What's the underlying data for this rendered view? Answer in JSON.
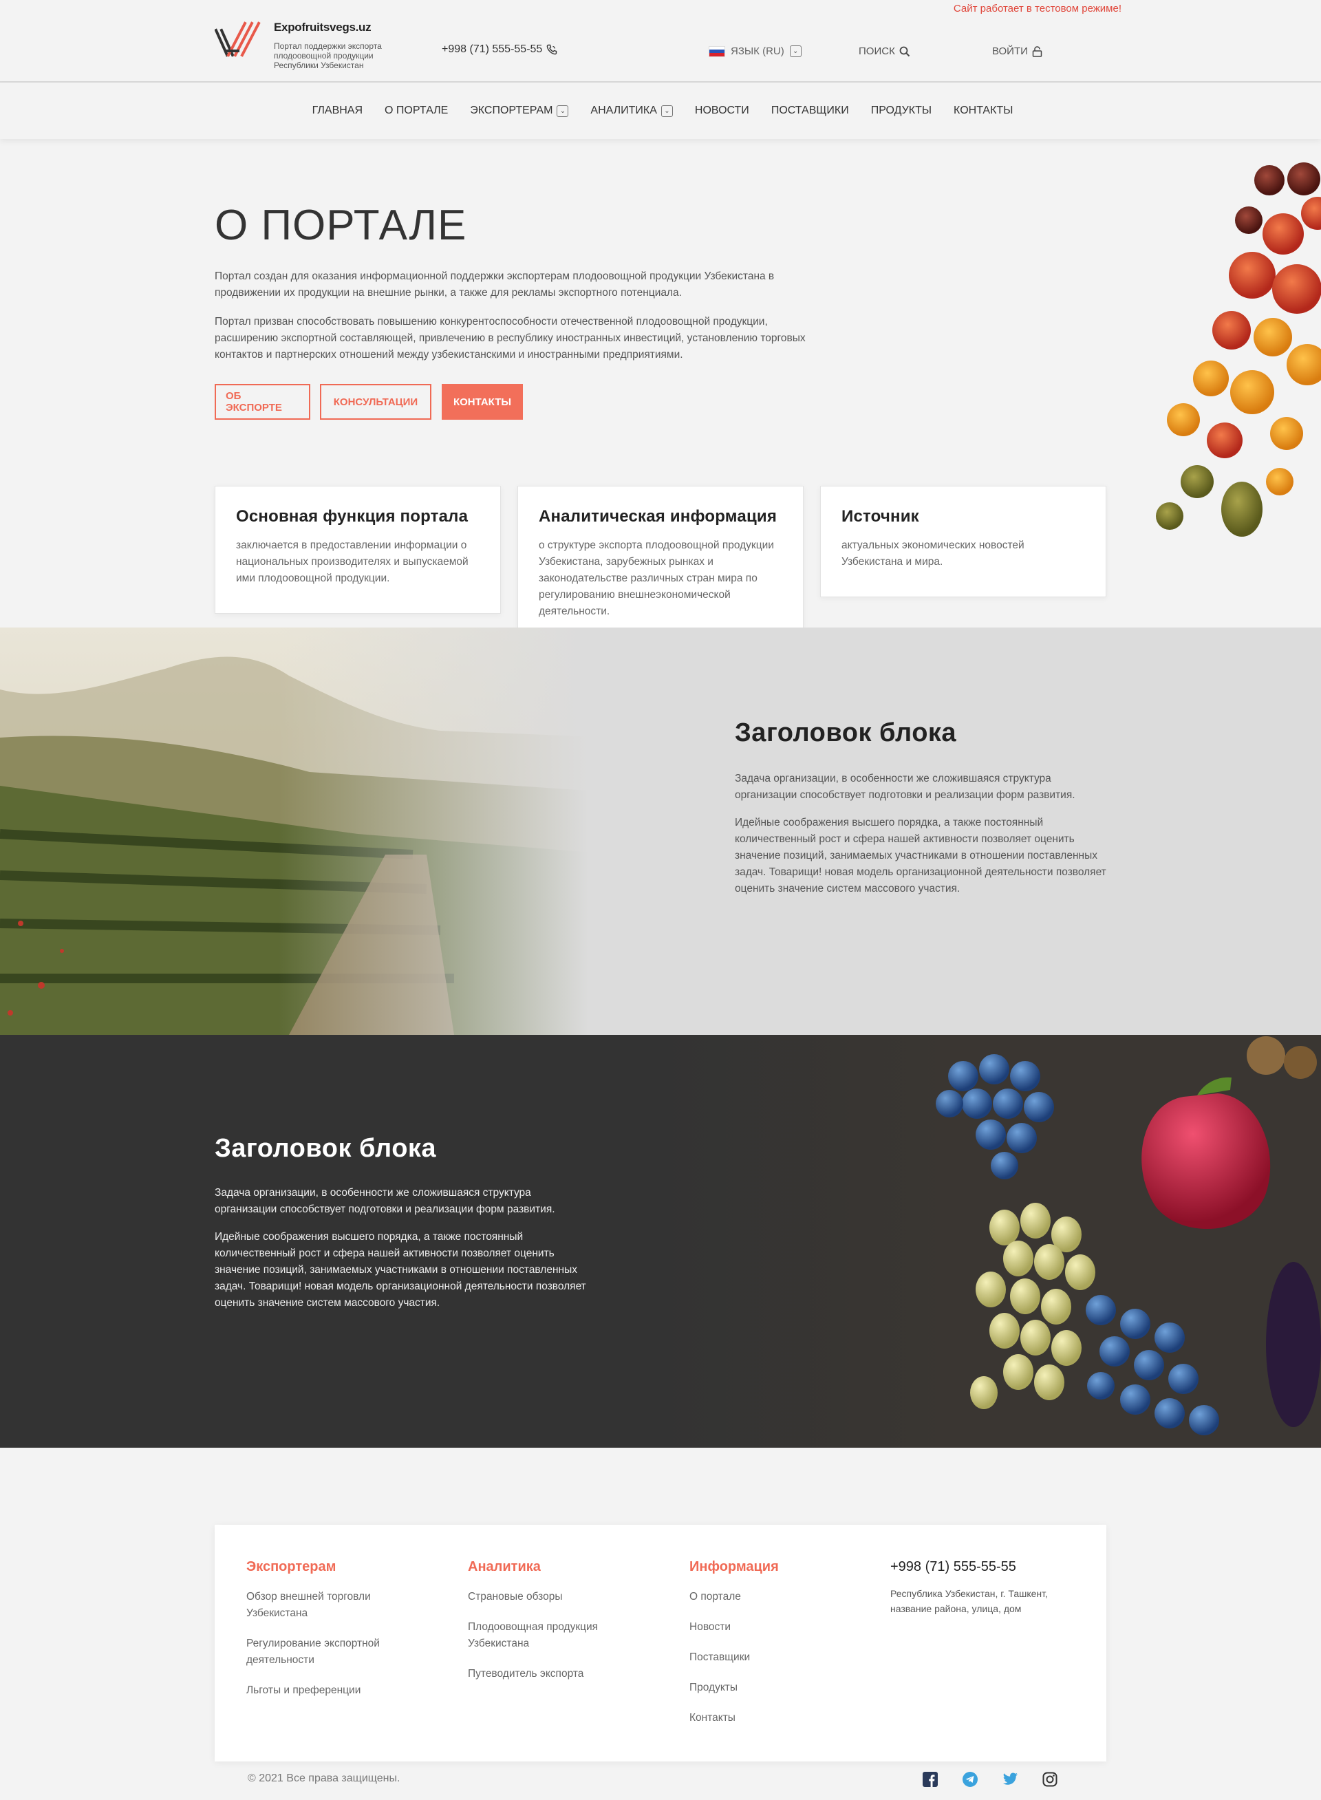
{
  "header": {
    "test_mode_notice": "Сайт работает в тестовом режиме!",
    "site_name": "Expofruitsvegs.uz",
    "site_description": "Портал поддержки экспорта плодоовощной продукции Республики Узбекистан",
    "phone": "+998 (71) 555-55-55",
    "language_label": "ЯЗЫК (RU)",
    "search_label": "ПОИСК",
    "login_label": "ВОЙТИ"
  },
  "nav": {
    "items": [
      {
        "label": "ГЛАВНАЯ"
      },
      {
        "label": "О ПОРТАЛЕ"
      },
      {
        "label": "ЭКСПОРТЕРАМ"
      },
      {
        "label": "АНАЛИТИКА"
      },
      {
        "label": "НОВОСТИ"
      },
      {
        "label": "ПОСТАВЩИКИ"
      },
      {
        "label": "ПРОДУКТЫ"
      },
      {
        "label": "КОНТАКТЫ"
      }
    ]
  },
  "hero": {
    "title": "О ПОРТАЛЕ",
    "paragraph_1": "Портал создан для оказания информационной поддержки  экспортерам плодоовощной продукции Узбекистана в продвижении их продукции на внешние рынки, а также для рекламы экспортного потенциала.",
    "paragraph_2": "Портал призван способствовать повышению конкурентоспособности отечественной плодоовощной продукции, расширению экспортной составляющей, привлечению в республику иностранных инвестиций, установлению торговых контактов и партнерских отношений между узбекистанскими и иностранными предприятиями.",
    "buttons": {
      "about_export": "ОБ ЭКСПОРТЕ",
      "consultations": "КОНСУЛЬТАЦИИ",
      "contacts": "КОНТАКТЫ"
    },
    "cards": [
      {
        "title": "Основная функция портала",
        "text": "заключается в предоставлении информации о национальных производителях и выпускаемой ими плодоовощной продукции."
      },
      {
        "title": "Аналитическая информация",
        "text": "о структуре экспорта плодоовощной продукции Узбекистана, зарубежных рынках и законодательстве различных стран мира по регулированию внешнеэкономической деятельности."
      },
      {
        "title": "Источник",
        "text": "актуальных экономических новостей Узбекистана и мира."
      }
    ]
  },
  "block_vineyard": {
    "title": "Заголовок блока",
    "paragraph_1": "Задача организации, в особенности же сложившаяся структура организации способствует подготовки и реализации форм развития.",
    "paragraph_2": "Идейные соображения высшего порядка, а также постоянный количественный рост и сфера нашей активности позволяет оценить значение позиций, занимаемых участниками в отношении поставленных задач. Товарищи! новая модель организационной деятельности позволяет оценить значение систем массового участия."
  },
  "block_dark": {
    "title": "Заголовок блока",
    "paragraph_1": "Задача организации, в особенности же сложившаяся структура организации способствует подготовки и реализации форм развития.",
    "paragraph_2": "Идейные соображения высшего порядка, а также постоянный количественный рост и сфера нашей активности позволяет оценить значение позиций, занимаемых участниками в отношении поставленных задач. Товарищи! новая модель организационной деятельности позволяет оценить значение систем массового участия."
  },
  "footer": {
    "col_exporters": {
      "title": "Экспортерам",
      "links": [
        "Обзор внешней торговли Узбекистана",
        "Регулирование экспортной деятельности",
        "Льготы и преференции"
      ]
    },
    "col_analytics": {
      "title": "Аналитика",
      "links": [
        "Страновые обзоры",
        "Плодоовощная продукция Узбекистана",
        "Путеводитель экспорта"
      ]
    },
    "col_info": {
      "title": "Информация",
      "links": [
        "О портале",
        "Новости",
        "Поставщики",
        "Продукты",
        "Контакты"
      ]
    },
    "contact": {
      "phone": "+998 (71) 555-55-55",
      "address": "Республика Узбекистан, г. Ташкент, название района, улица, дом"
    },
    "copyright": "© 2021 Все права защищены.",
    "socials": [
      "facebook-icon",
      "telegram-icon",
      "twitter-icon",
      "instagram-icon"
    ]
  },
  "colors": {
    "accent": "#f26f5a",
    "dark_section": "#333333",
    "page_background": "#f3f3f3"
  }
}
